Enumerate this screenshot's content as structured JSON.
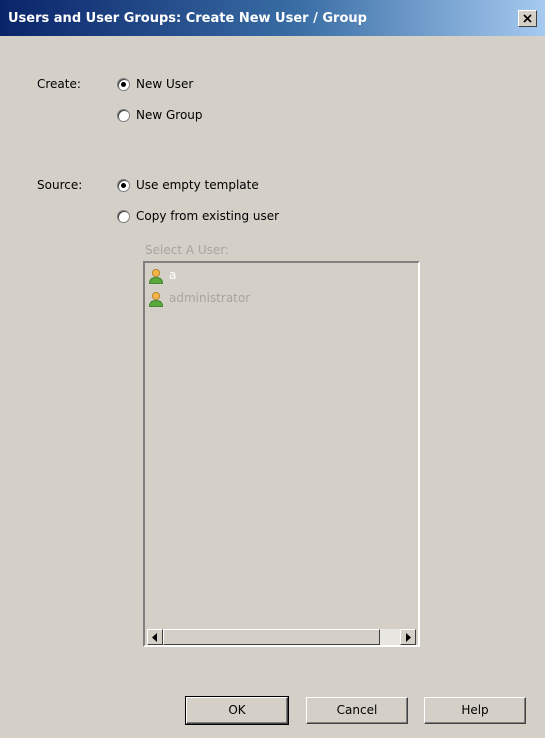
{
  "window": {
    "title": "Users and User Groups: Create New User / Group"
  },
  "create": {
    "label": "Create:",
    "options": [
      {
        "label": "New User",
        "selected": true
      },
      {
        "label": "New Group",
        "selected": false
      }
    ]
  },
  "source": {
    "label": "Source:",
    "options": [
      {
        "label": "Use empty template",
        "selected": true
      },
      {
        "label": "Copy from existing user",
        "selected": false
      }
    ]
  },
  "user_list": {
    "label": "Select A User:",
    "enabled": false,
    "items": [
      {
        "name": "a",
        "icon": "user-icon"
      },
      {
        "name": "administrator",
        "icon": "user-icon"
      }
    ]
  },
  "buttons": {
    "ok": "OK",
    "cancel": "Cancel",
    "help": "Help"
  },
  "colors": {
    "title_bar_start": "#0a246a",
    "title_bar_end": "#a6caf0",
    "dialog_background": "#d4d0c8",
    "disabled_text": "#a8a59e"
  }
}
